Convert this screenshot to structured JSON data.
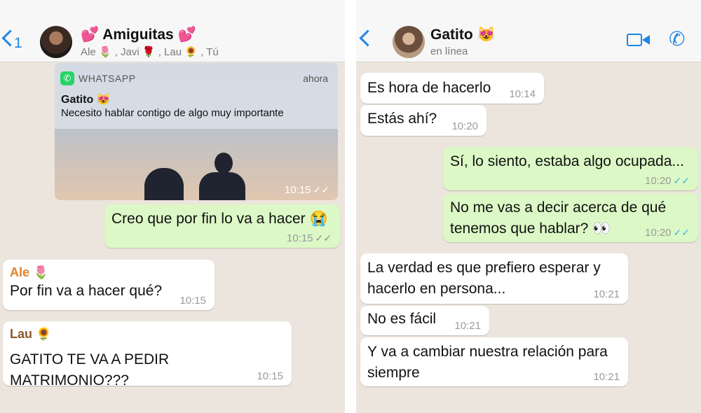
{
  "left_chat": {
    "unread_count": "1",
    "title": "💕 Amiguitas 💕",
    "members": "Ale 🌷 , Javi 🌹 , Lau 🌻 , Tú",
    "notification": {
      "app": "WHATSAPP",
      "time": "ahora",
      "sender": "Gatito 😻",
      "text": "Necesito hablar contigo de algo muy importante",
      "stamp": "10:15"
    },
    "messages": [
      {
        "text": "Creo que por fin lo va a hacer 😭",
        "time": "10:15"
      },
      {
        "sender": "Ale 🌷",
        "text": "Por fin va a hacer qué?",
        "time": "10:15"
      },
      {
        "sender": "Lau 🌻",
        "text": "GATITO TE VA A PEDIR MATRIMONIO???",
        "time": "10:15"
      }
    ]
  },
  "right_chat": {
    "title": "Gatito 😻",
    "status": "en línea",
    "messages": [
      {
        "text": "Es hora de hacerlo",
        "time": "10:14"
      },
      {
        "text": "Estás ahí?",
        "time": "10:20"
      },
      {
        "text": "Sí, lo siento, estaba algo ocupada...",
        "time": "10:20"
      },
      {
        "text1": "No me vas a decir acerca de qué",
        "text2": "tenemos que hablar? 👀",
        "time": "10:20"
      },
      {
        "text1": "La verdad es que prefiero esperar y",
        "text2": "hacerlo en persona...",
        "time": "10:21"
      },
      {
        "text": "No es fácil",
        "time": "10:21"
      },
      {
        "text1": "Y va a cambiar nuestra relación para",
        "text2": "siempre",
        "time": "10:21"
      }
    ]
  },
  "colors": {
    "accent": "#1f86e8",
    "outgoing_bubble": "#dcf8c6",
    "incoming_bubble": "#ffffff",
    "chat_background": "#ece5dd",
    "read_ticks": "#34b7f1",
    "ale_name": "#e0822c",
    "lau_name": "#8a5a2b"
  },
  "icons": [
    "back-chevron-icon",
    "video-call-icon",
    "phone-icon",
    "whatsapp-icon",
    "double-check-icon"
  ]
}
